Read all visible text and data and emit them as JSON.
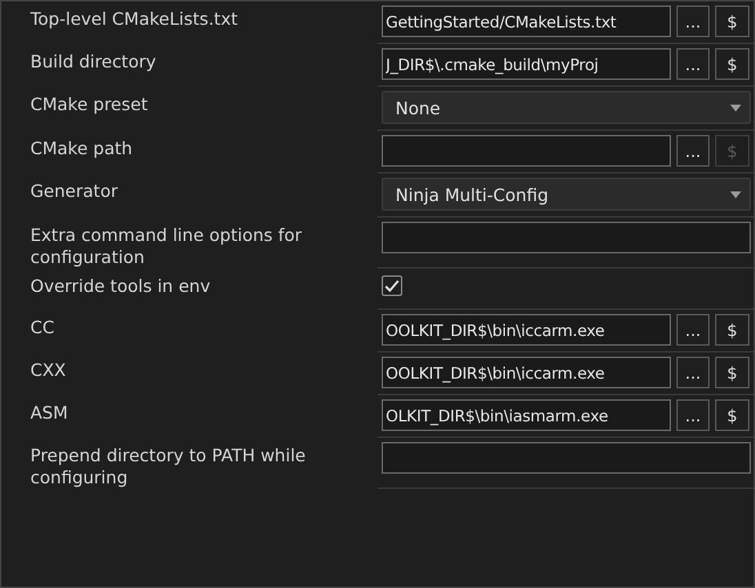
{
  "settings": [
    {
      "label": "Top-level CMakeLists.txt",
      "kind": "path",
      "value": "GettingStarted/CMakeLists.txt",
      "browse": "...",
      "macro": "$",
      "macro_disabled": false
    },
    {
      "label": "Build directory",
      "kind": "path",
      "value": "J_DIR$\\.cmake_build\\myProj",
      "browse": "...",
      "macro": "$",
      "macro_disabled": false
    },
    {
      "label": "CMake preset",
      "kind": "select",
      "value": "None"
    },
    {
      "label": "CMake path",
      "kind": "path",
      "browse": "...",
      "macro": "$",
      "macro_disabled": true
    },
    {
      "label": "Generator",
      "kind": "select",
      "value": "Ninja Multi-Config"
    },
    {
      "label": "Extra command line options for configuration",
      "kind": "text"
    },
    {
      "label": "Override tools in env",
      "kind": "checkbox",
      "checked": true
    },
    {
      "label": "CC",
      "kind": "path",
      "value": "OOLKIT_DIR$\\bin\\iccarm.exe",
      "browse": "...",
      "macro": "$",
      "macro_disabled": false
    },
    {
      "label": "CXX",
      "kind": "path",
      "value": "OOLKIT_DIR$\\bin\\iccarm.exe",
      "browse": "...",
      "macro": "$",
      "macro_disabled": false
    },
    {
      "label": "ASM",
      "kind": "path",
      "value": "OLKIT_DIR$\\bin\\iasmarm.exe",
      "browse": "...",
      "macro": "$",
      "macro_disabled": false
    },
    {
      "label": "Prepend directory to PATH while configuring",
      "kind": "text"
    }
  ]
}
